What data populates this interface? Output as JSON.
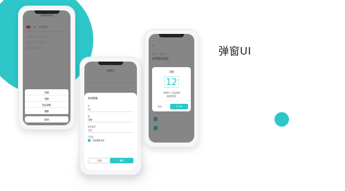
{
  "headline": "弹窗UI",
  "phone1": {
    "header": "完成卖房信息",
    "rows": [
      "+86",
      "手机号码"
    ],
    "options": [
      "拍照",
      "相册",
      "电话求助",
      "微聊"
    ],
    "cancel": "取消"
  },
  "phone2": {
    "header": "数据展示",
    "card_title": "添加表格",
    "field1_label": "名",
    "field1_value": "张",
    "field2_label": "姓",
    "field2_value": "国林",
    "field3_label": "性别选项",
    "field3_value": "女士",
    "check_label": "已同意",
    "check_text": "同意服务条款",
    "cancel": "取消",
    "confirm": "确定"
  },
  "phone3": {
    "subtitle": "第一步 · 第二步",
    "title": "选择服务类型",
    "modal_title": "口程",
    "number": "12",
    "desc1": "当前有1个正在处理",
    "desc2": "的委托项目",
    "cancel": "取消",
    "confirm": "下一步"
  },
  "colors": {
    "accent": "#2ec7c9"
  }
}
